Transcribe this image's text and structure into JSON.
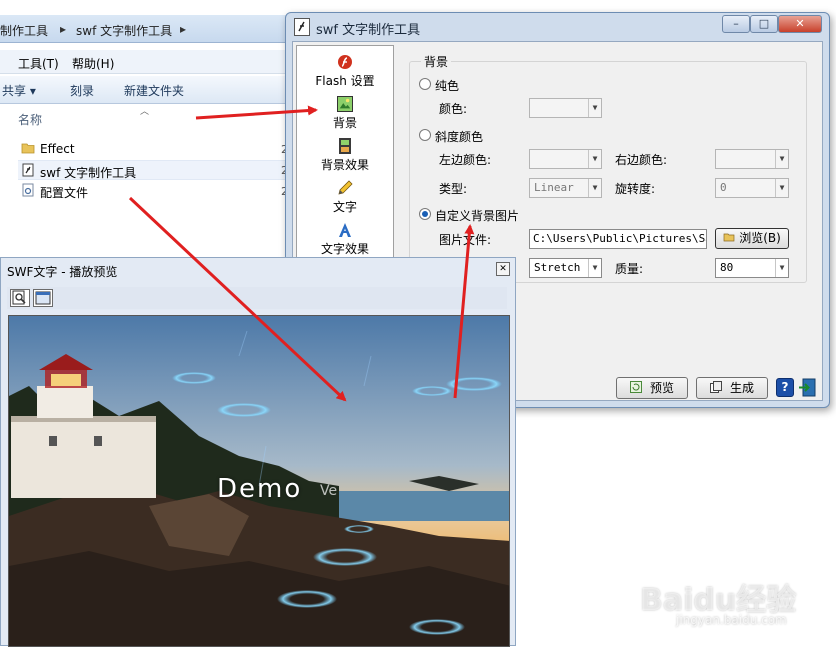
{
  "explorer": {
    "breadcrumb": [
      "制作工具",
      "swf 文字制作工具"
    ],
    "menu": [
      "工具(T)",
      "帮助(H)"
    ],
    "toolbar": [
      "共享 ▾",
      "刻录",
      "新建文件夹"
    ],
    "column_header": "名称",
    "files": [
      {
        "name": "Effect",
        "icon": "folder-icon"
      },
      {
        "name": "swf 文字制作工具",
        "icon": "app-file-icon"
      },
      {
        "name": "配置文件",
        "icon": "config-file-icon"
      }
    ],
    "date_fragment": "2"
  },
  "dialog": {
    "title": "swf 文字制作工具",
    "caption_buttons": {
      "minimize": "–",
      "maximize": "□",
      "close": "✕"
    },
    "sidebar": [
      {
        "label": "Flash 设置",
        "icon": "flash-icon"
      },
      {
        "label": "背景",
        "icon": "background-image-icon"
      },
      {
        "label": "背景效果",
        "icon": "film-icon"
      },
      {
        "label": "文字",
        "icon": "pencil-icon"
      },
      {
        "label": "文字效果",
        "icon": "text-effect-icon"
      }
    ],
    "group_title": "背景",
    "solid": {
      "label": "纯色",
      "color_label": "颜色:"
    },
    "gradient": {
      "label": "斜度颜色",
      "left_label": "左边颜色:",
      "right_label": "右边颜色:",
      "type_label": "类型:",
      "type_value": "Linear",
      "rotation_label": "旋转度:",
      "rotation_value": "0"
    },
    "custom": {
      "label": "自定义背景图片",
      "file_label": "图片文件:",
      "file_path": "C:\\Users\\Public\\Pictures\\Samp",
      "browse_label": "浏览(B)",
      "stretch_value": "Stretch",
      "quality_label": "质量:",
      "quality_value": "80"
    },
    "selected_option": "custom",
    "preview_button": "预览",
    "generate_button": "生成",
    "help_button": "?"
  },
  "preview": {
    "title": "SWF文字 - 播放预览",
    "close": "✕",
    "demo_text": "Demo",
    "demo_tail": "Ve"
  },
  "watermark": {
    "logo": "Baidu经验",
    "url": "jingyan.baidu.com"
  },
  "colors": {
    "accent": "#1a5fb4",
    "arrow": "#e02020",
    "dialog_frame": "#cfdcec"
  }
}
